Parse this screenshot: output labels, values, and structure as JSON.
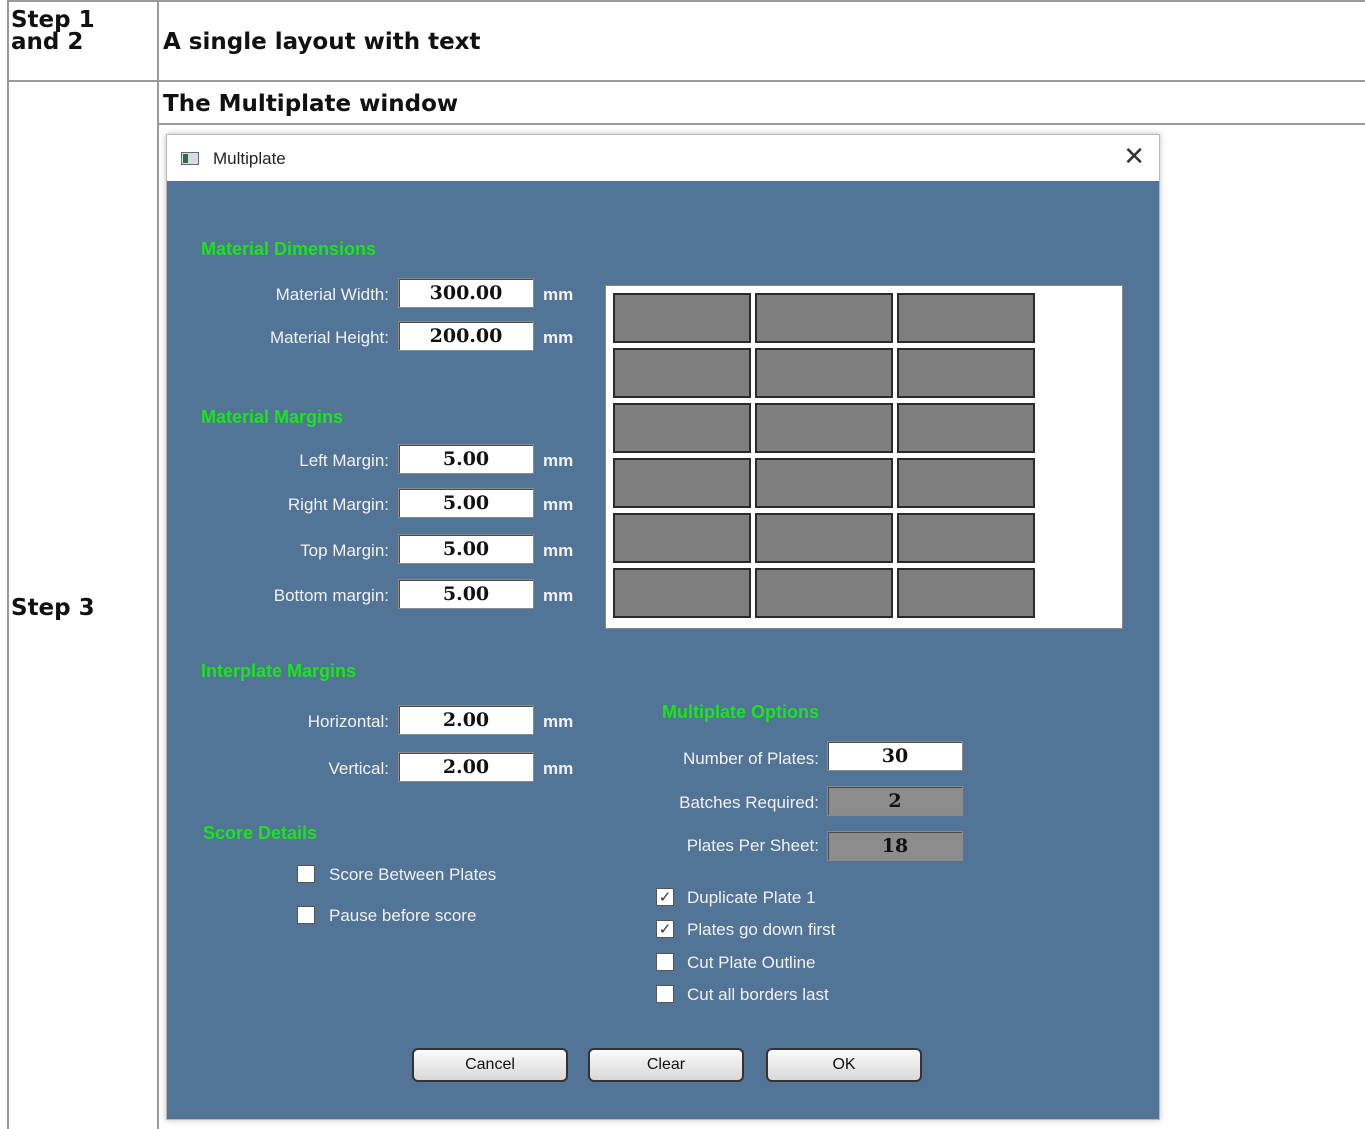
{
  "table": {
    "row1_step": "Step 1 and 2",
    "row1_content": "A single layout with text",
    "row2_step": "Step 3",
    "row2_header": "The Multiplate window"
  },
  "window": {
    "title": "Multiplate",
    "close_glyph": "✕",
    "icon": "app-window-icon"
  },
  "material_dimensions": {
    "heading": "Material Dimensions",
    "width_label": "Material Width:",
    "width_value": "300.00",
    "height_label": "Material Height:",
    "height_value": "200.00",
    "unit": "mm"
  },
  "material_margins": {
    "heading": "Material Margins",
    "left_label": "Left Margin:",
    "left_value": "5.00",
    "right_label": "Right Margin:",
    "right_value": "5.00",
    "top_label": "Top Margin:",
    "top_value": "5.00",
    "bottom_label": "Bottom margin:",
    "bottom_value": "5.00",
    "unit": "mm"
  },
  "interplate_margins": {
    "heading": "Interplate Margins",
    "horizontal_label": "Horizontal:",
    "horizontal_value": "2.00",
    "vertical_label": "Vertical:",
    "vertical_value": "2.00",
    "unit": "mm"
  },
  "score_details": {
    "heading": "Score Details",
    "score_between_label": "Score Between Plates",
    "score_between_checked": false,
    "pause_label": "Pause before score",
    "pause_checked": false
  },
  "multiplate_options": {
    "heading": "Multiplate Options",
    "number_label": "Number of Plates:",
    "number_value": "30",
    "batches_label": "Batches Required:",
    "batches_value": "2",
    "per_sheet_label": "Plates Per Sheet:",
    "per_sheet_value": "18",
    "duplicate_label": "Duplicate Plate 1",
    "duplicate_checked": true,
    "down_first_label": "Plates go down first",
    "down_first_checked": true,
    "cut_outline_label": "Cut Plate Outline",
    "cut_outline_checked": false,
    "cut_borders_label": "Cut all borders last",
    "cut_borders_checked": false,
    "check_glyph": "✓"
  },
  "preview": {
    "columns": 3,
    "rows": 6
  },
  "buttons": {
    "cancel": "Cancel",
    "clear": "Clear",
    "ok": "OK"
  },
  "colors": {
    "dialog_bg": "#527497",
    "heading_green": "#19e619",
    "plate_fill": "#7f7f7f"
  }
}
